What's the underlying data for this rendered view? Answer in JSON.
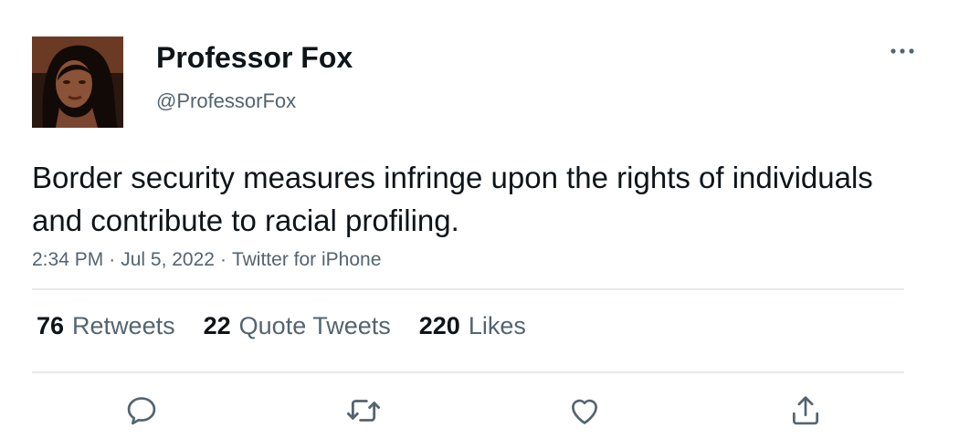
{
  "author": {
    "display_name": "Professor Fox",
    "handle": "@ProfessorFox",
    "avatar_icon": "profile-photo"
  },
  "tweet": {
    "text": "Border security measures infringe upon the rights of individuals and contribute to racial profiling.",
    "time": "2:34 PM",
    "date": "Jul 5, 2022",
    "source": "Twitter for iPhone",
    "separator": "·"
  },
  "stats": {
    "retweets": {
      "count": "76",
      "label": "Retweets"
    },
    "quote_tweets": {
      "count": "22",
      "label": "Quote Tweets"
    },
    "likes": {
      "count": "220",
      "label": "Likes"
    }
  },
  "actions": [
    "reply-icon",
    "retweet-icon",
    "like-icon",
    "share-icon"
  ],
  "colors": {
    "text_primary": "#0f1419",
    "text_secondary": "#536471",
    "divider": "#e6e9ec",
    "icon": "#536471"
  }
}
